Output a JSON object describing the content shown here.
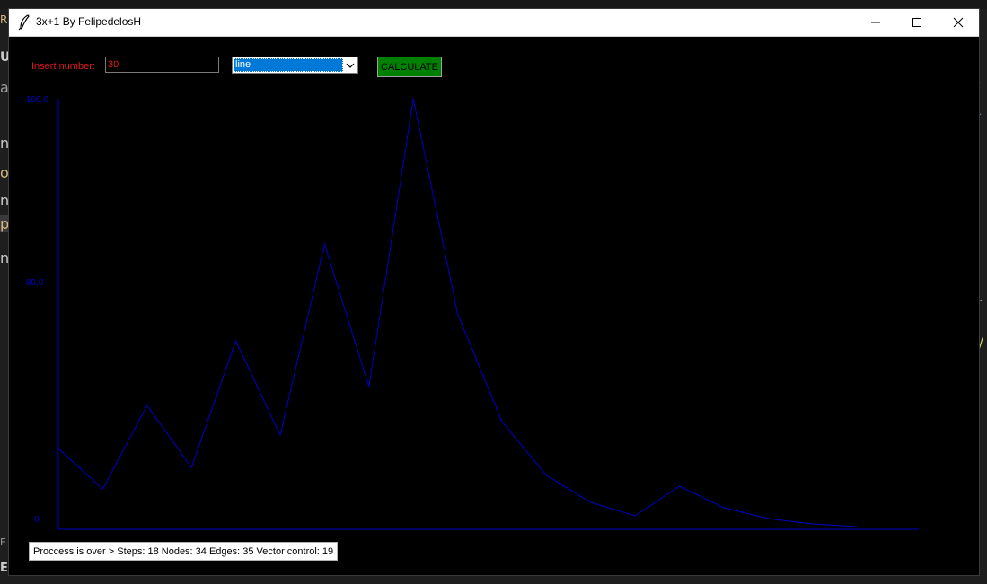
{
  "window": {
    "title": "3x+1 By FelipedelosH"
  },
  "controls": {
    "insert_label": "Insert number:",
    "number_value": "30",
    "chart_type_selected": "line",
    "calculate_label": "CALCULATE"
  },
  "status": {
    "text": "Proccess is over > Steps: 18 Nodes: 34 Edges: 35 Vector control: 19"
  },
  "colors": {
    "line": "#0000c8",
    "axis": "#0000c8",
    "label_red": "#e01818",
    "button_green": "#008000"
  },
  "chart_data": {
    "type": "line",
    "x": [
      1,
      2,
      3,
      4,
      5,
      6,
      7,
      8,
      9,
      10,
      11,
      12,
      13,
      14,
      15,
      16,
      17,
      18,
      19,
      20
    ],
    "values": [
      30,
      15,
      46,
      23,
      70,
      35,
      106,
      53,
      160,
      80,
      40,
      20,
      10,
      5,
      16,
      8,
      4,
      2,
      1,
      null
    ],
    "y_tick_labels": [
      "160.0",
      "80.0",
      "0"
    ],
    "ylim": [
      0,
      160
    ],
    "grid": false
  },
  "background": {
    "frag_1": "R",
    "frag_2": "UI",
    "frag_3": "a",
    "frag_4": "nc",
    "frag_5": "o",
    "frag_6": "n.",
    "frag_7": "p",
    "frag_8": "n",
    "frag_9": "E",
    "frag_10": "E"
  }
}
